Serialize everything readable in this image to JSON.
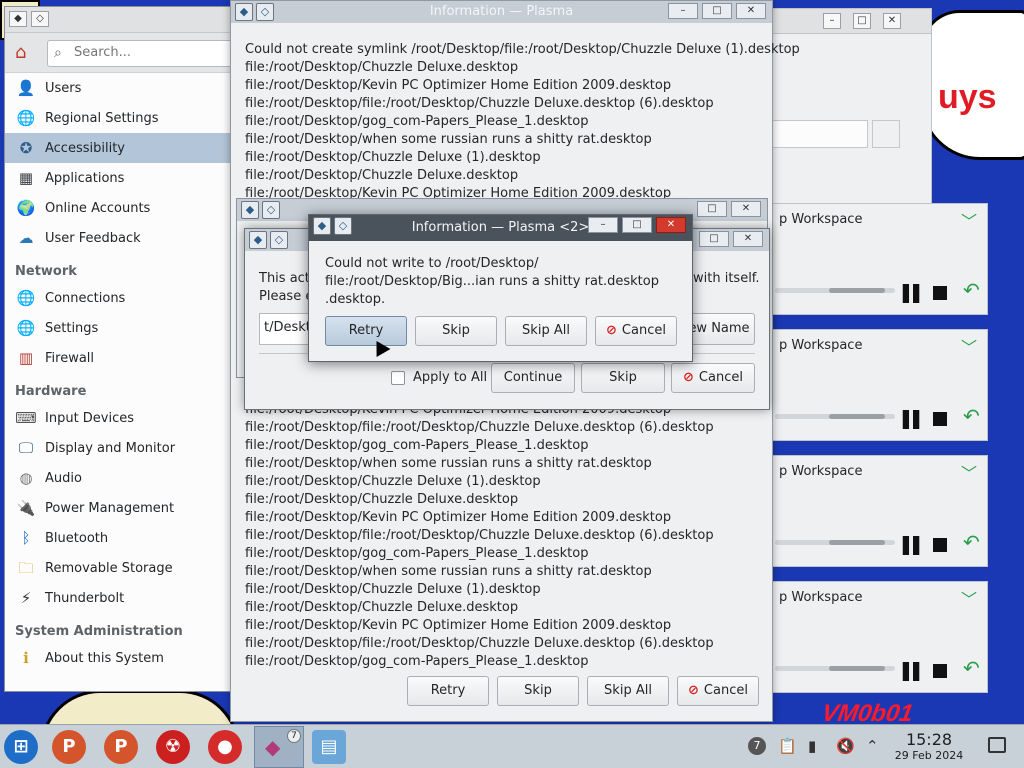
{
  "settings": {
    "search_placeholder": "Search...",
    "items": [
      {
        "label": "Users",
        "icon": "users-icon",
        "glyph": "👤"
      },
      {
        "label": "Regional Settings",
        "icon": "globe-flag-icon",
        "glyph": "🌐"
      },
      {
        "label": "Accessibility",
        "icon": "accessibility-icon",
        "glyph": "✪"
      },
      {
        "label": "Applications",
        "icon": "applications-icon",
        "glyph": "▦"
      },
      {
        "label": "Online Accounts",
        "icon": "online-accounts-icon",
        "glyph": "🌍"
      },
      {
        "label": "User Feedback",
        "icon": "user-feedback-icon",
        "glyph": "☁"
      }
    ],
    "network_heading": "Network",
    "network_items": [
      {
        "label": "Connections",
        "icon": "connections-icon",
        "glyph": "🌐"
      },
      {
        "label": "Settings",
        "icon": "network-settings-icon",
        "glyph": "🌐"
      },
      {
        "label": "Firewall",
        "icon": "firewall-icon",
        "glyph": "▥"
      }
    ],
    "hardware_heading": "Hardware",
    "hardware_items": [
      {
        "label": "Input Devices",
        "icon": "input-devices-icon",
        "glyph": "⌨"
      },
      {
        "label": "Display and Monitor",
        "icon": "display-icon",
        "glyph": "🖵"
      },
      {
        "label": "Audio",
        "icon": "audio-icon",
        "glyph": "◍"
      },
      {
        "label": "Power Management",
        "icon": "power-management-icon",
        "glyph": "🔌"
      },
      {
        "label": "Bluetooth",
        "icon": "bluetooth-icon",
        "glyph": "ᛒ"
      },
      {
        "label": "Removable Storage",
        "icon": "removable-storage-icon",
        "glyph": "🗀"
      },
      {
        "label": "Thunderbolt",
        "icon": "thunderbolt-icon",
        "glyph": "⚡"
      }
    ],
    "sysadmin_heading": "System Administration",
    "sysadmin_items": [
      {
        "label": "About this System",
        "icon": "about-system-icon",
        "glyph": "ℹ"
      }
    ]
  },
  "info_main": {
    "title": "Information — Plasma",
    "lines_top": [
      "Could not create symlink /root/Desktop/file:/root/Desktop/Chuzzle Deluxe (1).desktop",
      "file:/root/Desktop/Chuzzle Deluxe.desktop",
      "file:/root/Desktop/Kevin PC Optimizer Home Edition 2009.desktop",
      "file:/root/Desktop/file:/root/Desktop/Chuzzle Deluxe.desktop (6).desktop",
      "file:/root/Desktop/gog_com-Papers_Please_1.desktop",
      "file:/root/Desktop/when some russian runs a shitty rat.desktop",
      "file:/root/Desktop/Chuzzle Deluxe (1).desktop",
      "file:/root/Desktop/Chuzzle Deluxe.desktop",
      "file:/root/Desktop/Kevin PC Optimizer Home Edition 2009.desktop"
    ],
    "lines_bottom": [
      "file:/root/Desktop/Kevin PC Optimizer Home Edition 2009.desktop",
      "file:/root/Desktop/file:/root/Desktop/Chuzzle Deluxe.desktop (6).desktop",
      "file:/root/Desktop/gog_com-Papers_Please_1.desktop",
      "file:/root/Desktop/when some russian runs a shitty rat.desktop",
      "file:/root/Desktop/Chuzzle Deluxe (1).desktop",
      "file:/root/Desktop/Chuzzle Deluxe.desktop",
      "file:/root/Desktop/Kevin PC Optimizer Home Edition 2009.desktop",
      "file:/root/Desktop/file:/root/Desktop/Chuzzle Deluxe.desktop (6).desktop",
      "file:/root/Desktop/gog_com-Papers_Please_1.desktop",
      "file:/root/Desktop/when some russian runs a shitty rat.desktop",
      "file:/root/Desktop/Chuzzle Deluxe (1).desktop",
      "file:/root/Desktop/Chuzzle Deluxe.desktop",
      "file:/root/Desktop/Kevin PC Optimizer Home Edition 2009.desktop",
      "file:/root/Desktop/file:/root/Desktop/Chuzzle Deluxe.desktop (6).desktop",
      "file:/root/Desktop/gog_com-Papers_Please_1.desktop"
    ],
    "buttons": {
      "retry": "Retry",
      "skip": "Skip",
      "skip_all": "Skip All",
      "cancel": "Cancel"
    }
  },
  "dialog_mid": {
    "message_1": "This acti",
    "message_1_end": "with itself.",
    "message_2": "Please e",
    "path_value": "t/Deskto",
    "new_name": "ew Name",
    "apply_to_all": "Apply to All",
    "continue": "Continue",
    "skip": "Skip",
    "cancel": "Cancel"
  },
  "dialog_front": {
    "title": "Information — Plasma <2>",
    "line1": "Could not write to /root/Desktop/",
    "line2": "file:/root/Desktop/Big...ian runs a shitty rat.desktop",
    "line3": ".desktop.",
    "retry": "Retry",
    "skip": "Skip",
    "skip_all": "Skip All",
    "cancel": "Cancel"
  },
  "panels": {
    "workspace_label": "p Workspace"
  },
  "wallpaper": {
    "text": "uys",
    "signature": "VM0b01"
  },
  "taskbar": {
    "badge_count": "7",
    "tray_badge": "7",
    "time": "15:28",
    "date": "29 Feb 2024"
  }
}
